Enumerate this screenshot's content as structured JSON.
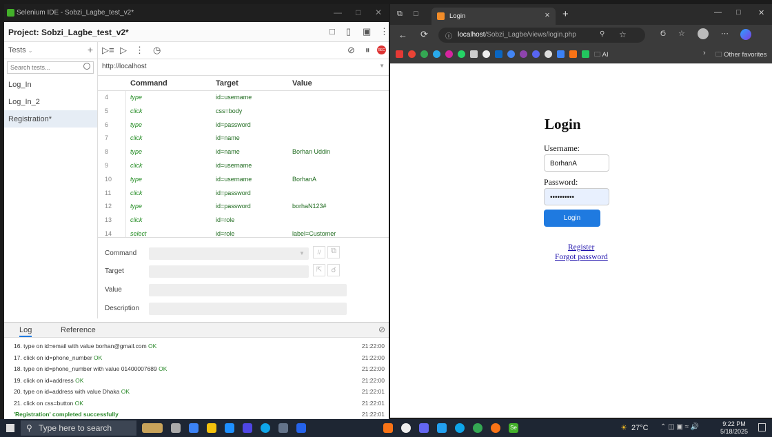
{
  "ide": {
    "window_title": "Selenium IDE - Sobzi_Lagbe_test_v2*",
    "project_title": "Project: Sobzi_Lagbe_test_v2*",
    "tests_dropdown": "Tests",
    "search_placeholder": "Search tests...",
    "tests": [
      "Log_In",
      "Log_In_2",
      "Registration*"
    ],
    "base_url": "http://localhost",
    "columns": {
      "command": "Command",
      "target": "Target",
      "value": "Value"
    },
    "commands": [
      {
        "n": "4",
        "command": "type",
        "target": "id=username",
        "value": ""
      },
      {
        "n": "5",
        "command": "click",
        "target": "css=body",
        "value": ""
      },
      {
        "n": "6",
        "command": "type",
        "target": "id=password",
        "value": ""
      },
      {
        "n": "7",
        "command": "click",
        "target": "id=name",
        "value": ""
      },
      {
        "n": "8",
        "command": "type",
        "target": "id=name",
        "value": "Borhan Uddin"
      },
      {
        "n": "9",
        "command": "click",
        "target": "id=username",
        "value": ""
      },
      {
        "n": "10",
        "command": "type",
        "target": "id=username",
        "value": "BorhanA"
      },
      {
        "n": "11",
        "command": "click",
        "target": "id=password",
        "value": ""
      },
      {
        "n": "12",
        "command": "type",
        "target": "id=password",
        "value": "borhaN123#"
      },
      {
        "n": "13",
        "command": "click",
        "target": "id=role",
        "value": ""
      },
      {
        "n": "14",
        "command": "select",
        "target": "id=role",
        "value": "label=Customer"
      }
    ],
    "editor": {
      "command": "Command",
      "target": "Target",
      "value": "Value",
      "description": "Description"
    },
    "log_tabs": {
      "log": "Log",
      "reference": "Reference"
    },
    "log": [
      {
        "text": "16. type on id=email with value borhan@gmail.com",
        "status": "OK",
        "time": "21:22:00"
      },
      {
        "text": "17. click on id=phone_number",
        "status": "OK",
        "time": "21:22:00"
      },
      {
        "text": "18. type on id=phone_number with value 01400007689",
        "status": "OK",
        "time": "21:22:00"
      },
      {
        "text": "19. click on id=address",
        "status": "OK",
        "time": "21:22:00"
      },
      {
        "text": "20. type on id=address with value Dhaka",
        "status": "OK",
        "time": "21:22:01"
      },
      {
        "text": "21. click on css=button",
        "status": "OK",
        "time": "21:22:01"
      }
    ],
    "completed": "'Registration' completed successfully",
    "completed_time": "21:22:01"
  },
  "browser": {
    "tab_title": "Login",
    "url_host": "localhost",
    "url_path": "/Sobzi_Lagbe/views/login.php",
    "bookmark_folder_ai": "AI",
    "other_favorites": "Other favorites",
    "page": {
      "title": "Login",
      "username_label": "Username:",
      "username_value": "BorhanA",
      "password_label": "Password:",
      "password_value": "••••••••••",
      "login_button": "Login",
      "register_link": "Register",
      "forgot_link": "Forgot password"
    }
  },
  "taskbar": {
    "search_placeholder": "Type here to search",
    "temperature": "27°C",
    "time": "9:22 PM",
    "date": "5/18/2025"
  },
  "colors": {
    "accent": "#1f7ae0",
    "ok_green": "#2c8a2c",
    "command_green": "#1f8a1f"
  }
}
